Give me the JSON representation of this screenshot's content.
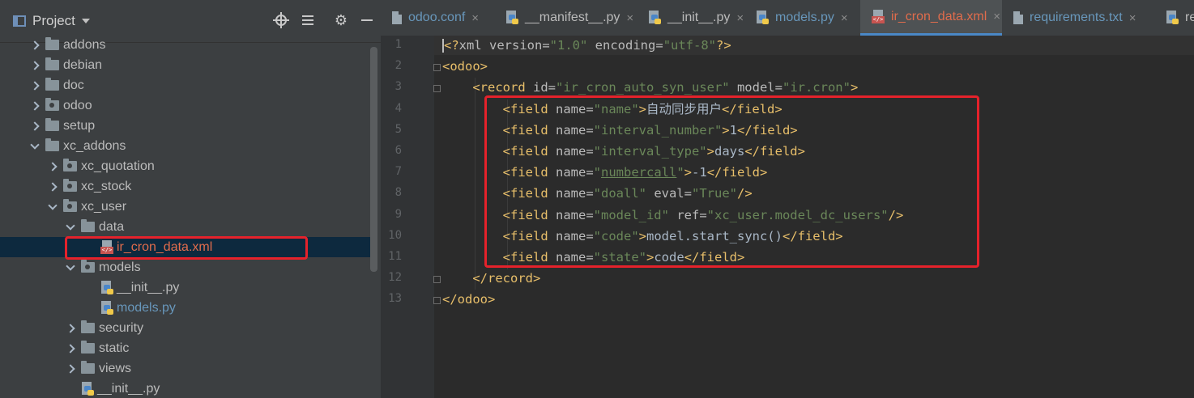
{
  "project": {
    "title": "Project",
    "tree": [
      {
        "label": "addons",
        "indent": 0,
        "state": "collapsed",
        "icon": "folder"
      },
      {
        "label": "debian",
        "indent": 0,
        "state": "collapsed",
        "icon": "folder"
      },
      {
        "label": "doc",
        "indent": 0,
        "state": "collapsed",
        "icon": "folder"
      },
      {
        "label": "odoo",
        "indent": 0,
        "state": "collapsed",
        "icon": "package"
      },
      {
        "label": "setup",
        "indent": 0,
        "state": "collapsed",
        "icon": "folder"
      },
      {
        "label": "xc_addons",
        "indent": 0,
        "state": "expanded",
        "icon": "folder"
      },
      {
        "label": "xc_quotation",
        "indent": 1,
        "state": "collapsed",
        "icon": "package"
      },
      {
        "label": "xc_stock",
        "indent": 1,
        "state": "collapsed",
        "icon": "package"
      },
      {
        "label": "xc_user",
        "indent": 1,
        "state": "expanded",
        "icon": "package"
      },
      {
        "label": "data",
        "indent": 2,
        "state": "expanded",
        "icon": "folder"
      },
      {
        "label": "ir_cron_data.xml",
        "indent": 3,
        "state": "leaf",
        "icon": "xml",
        "selected": true,
        "style": "err"
      },
      {
        "label": "models",
        "indent": 2,
        "state": "expanded",
        "icon": "package"
      },
      {
        "label": "__init__.py",
        "indent": 3,
        "state": "leaf",
        "icon": "py"
      },
      {
        "label": "models.py",
        "indent": 3,
        "state": "leaf",
        "icon": "py",
        "style": "link"
      },
      {
        "label": "security",
        "indent": 2,
        "state": "collapsed",
        "icon": "folder"
      },
      {
        "label": "static",
        "indent": 2,
        "state": "collapsed",
        "icon": "folder"
      },
      {
        "label": "views",
        "indent": 2,
        "state": "collapsed",
        "icon": "folder"
      },
      {
        "label": "__init__.py",
        "indent": 2,
        "state": "leaf",
        "icon": "py"
      }
    ]
  },
  "tabs": [
    {
      "label": "odoo.conf",
      "icon": "file",
      "style": "link"
    },
    {
      "label": "__manifest__.py",
      "icon": "py"
    },
    {
      "label": "__init__.py",
      "icon": "py"
    },
    {
      "label": "models.py",
      "icon": "py",
      "style": "link"
    },
    {
      "label": "ir_cron_data.xml",
      "icon": "xml",
      "style": "err",
      "active": true
    },
    {
      "label": "requirements.txt",
      "icon": "file",
      "style": "link"
    },
    {
      "label": "re",
      "icon": "py"
    }
  ],
  "close_glyph": "×",
  "editor": {
    "line_numbers": [
      "1",
      "2",
      "3",
      "4",
      "5",
      "6",
      "7",
      "8",
      "9",
      "10",
      "11",
      "12",
      "13"
    ],
    "lines": [
      [
        {
          "t": "<?",
          "c": "tag"
        },
        {
          "t": "xml version",
          "c": "attr"
        },
        {
          "t": "=",
          "c": "attr"
        },
        {
          "t": "\"1.0\"",
          "c": "val"
        },
        {
          "t": " encoding",
          "c": "attr"
        },
        {
          "t": "=",
          "c": "attr"
        },
        {
          "t": "\"utf-8\"",
          "c": "val"
        },
        {
          "t": "?>",
          "c": "tag"
        }
      ],
      [
        {
          "t": "<odoo>",
          "c": "tag"
        }
      ],
      [
        {
          "t": "    <record ",
          "c": "tag"
        },
        {
          "t": "id",
          "c": "attr"
        },
        {
          "t": "=",
          "c": "attr"
        },
        {
          "t": "\"ir_cron_auto_syn_user\"",
          "c": "val"
        },
        {
          "t": " model",
          "c": "attr"
        },
        {
          "t": "=",
          "c": "attr"
        },
        {
          "t": "\"ir.cron\"",
          "c": "val"
        },
        {
          "t": ">",
          "c": "tag"
        }
      ],
      [
        {
          "t": "        <field ",
          "c": "tag"
        },
        {
          "t": "name",
          "c": "attr"
        },
        {
          "t": "=",
          "c": "attr"
        },
        {
          "t": "\"name\"",
          "c": "val"
        },
        {
          "t": ">",
          "c": "tag"
        },
        {
          "t": "自动同步用户",
          "c": "text"
        },
        {
          "t": "</field>",
          "c": "tag"
        }
      ],
      [
        {
          "t": "        <field ",
          "c": "tag"
        },
        {
          "t": "name",
          "c": "attr"
        },
        {
          "t": "=",
          "c": "attr"
        },
        {
          "t": "\"interval_number\"",
          "c": "val"
        },
        {
          "t": ">",
          "c": "tag"
        },
        {
          "t": "1",
          "c": "text"
        },
        {
          "t": "</field>",
          "c": "tag"
        }
      ],
      [
        {
          "t": "        <field ",
          "c": "tag"
        },
        {
          "t": "name",
          "c": "attr"
        },
        {
          "t": "=",
          "c": "attr"
        },
        {
          "t": "\"interval_type\"",
          "c": "val"
        },
        {
          "t": ">",
          "c": "tag"
        },
        {
          "t": "days",
          "c": "text"
        },
        {
          "t": "</field>",
          "c": "tag"
        }
      ],
      [
        {
          "t": "        <field ",
          "c": "tag"
        },
        {
          "t": "name",
          "c": "attr"
        },
        {
          "t": "=",
          "c": "attr"
        },
        {
          "t": "\"",
          "c": "val"
        },
        {
          "t": "numbercall",
          "c": "val",
          "u": true
        },
        {
          "t": "\"",
          "c": "val"
        },
        {
          "t": ">",
          "c": "tag"
        },
        {
          "t": "-1",
          "c": "text"
        },
        {
          "t": "</field>",
          "c": "tag"
        }
      ],
      [
        {
          "t": "        <field ",
          "c": "tag"
        },
        {
          "t": "name",
          "c": "attr"
        },
        {
          "t": "=",
          "c": "attr"
        },
        {
          "t": "\"doall\"",
          "c": "val"
        },
        {
          "t": " eval",
          "c": "attr"
        },
        {
          "t": "=",
          "c": "attr"
        },
        {
          "t": "\"True\"",
          "c": "val"
        },
        {
          "t": "/>",
          "c": "tag"
        }
      ],
      [
        {
          "t": "        <field ",
          "c": "tag"
        },
        {
          "t": "name",
          "c": "attr"
        },
        {
          "t": "=",
          "c": "attr"
        },
        {
          "t": "\"model_id\"",
          "c": "val"
        },
        {
          "t": " ref",
          "c": "attr"
        },
        {
          "t": "=",
          "c": "attr"
        },
        {
          "t": "\"xc_user.model_dc_users\"",
          "c": "val"
        },
        {
          "t": "/>",
          "c": "tag"
        }
      ],
      [
        {
          "t": "        <field ",
          "c": "tag"
        },
        {
          "t": "name",
          "c": "attr"
        },
        {
          "t": "=",
          "c": "attr"
        },
        {
          "t": "\"code\"",
          "c": "val"
        },
        {
          "t": ">",
          "c": "tag"
        },
        {
          "t": "model.start_sync()",
          "c": "text"
        },
        {
          "t": "</field>",
          "c": "tag"
        }
      ],
      [
        {
          "t": "        <field ",
          "c": "tag"
        },
        {
          "t": "name",
          "c": "attr"
        },
        {
          "t": "=",
          "c": "attr"
        },
        {
          "t": "\"state\"",
          "c": "val"
        },
        {
          "t": ">",
          "c": "tag"
        },
        {
          "t": "code",
          "c": "text"
        },
        {
          "t": "</field>",
          "c": "tag"
        }
      ],
      [
        {
          "t": "    </record>",
          "c": "tag"
        }
      ],
      [
        {
          "t": "</odoo>",
          "c": "tag"
        }
      ]
    ]
  },
  "colors": {
    "annotation": "#e5222b",
    "selection": "#0d293e",
    "active_tab_underline": "#4a88c7"
  }
}
